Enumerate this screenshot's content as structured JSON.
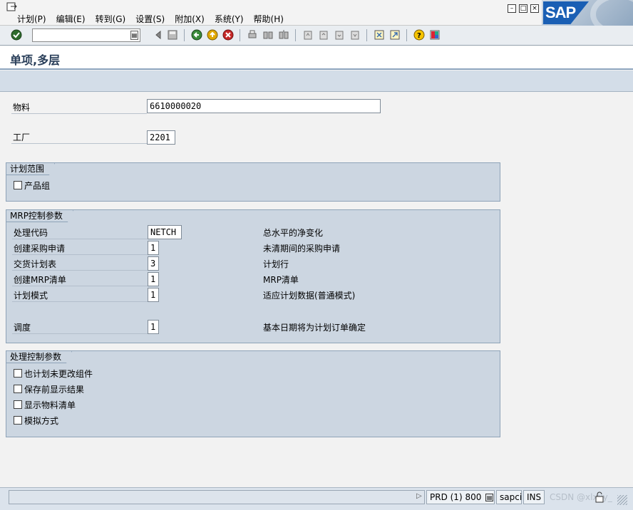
{
  "menu": [
    "计划(P)",
    "编辑(E)",
    "转到(G)",
    "设置(S)",
    "附加(X)",
    "系统(Y)",
    "帮助(H)"
  ],
  "sap_logo": "SAP",
  "title": "单项,多层",
  "fields": {
    "material_label": "物料",
    "material_value": "6610000020",
    "plant_label": "工厂",
    "plant_value": "2201"
  },
  "planning_scope": {
    "title": "计划范围",
    "product_group": "产品组"
  },
  "mrp_params": {
    "title": "MRP控制参数",
    "rows": [
      {
        "label": "处理代码",
        "value": "NETCH",
        "desc": "总水平的净变化"
      },
      {
        "label": "创建采购申请",
        "value": "1",
        "desc": "未清期间的采购申请"
      },
      {
        "label": "交货计划表",
        "value": "3",
        "desc": "计划行"
      },
      {
        "label": "创建MRP清单",
        "value": "1",
        "desc": "MRP清单"
      },
      {
        "label": "计划模式",
        "value": "1",
        "desc": "适应计划数据(普通模式)"
      },
      {
        "label": "调度",
        "value": "1",
        "desc": "基本日期将为计划订单确定"
      }
    ]
  },
  "process_params": {
    "title": "处理控制参数",
    "options": [
      "也计划未更改组件",
      "保存前显示结果",
      "显示物料清单",
      "模拟方式"
    ]
  },
  "status": {
    "system": "PRD (1) 800",
    "server": "sapci",
    "mode": "INS",
    "watermark": "CSDN @xlxxy_"
  },
  "colors": {
    "group_bg": "#ccd6e1",
    "title_text": "#2a3f5a"
  }
}
